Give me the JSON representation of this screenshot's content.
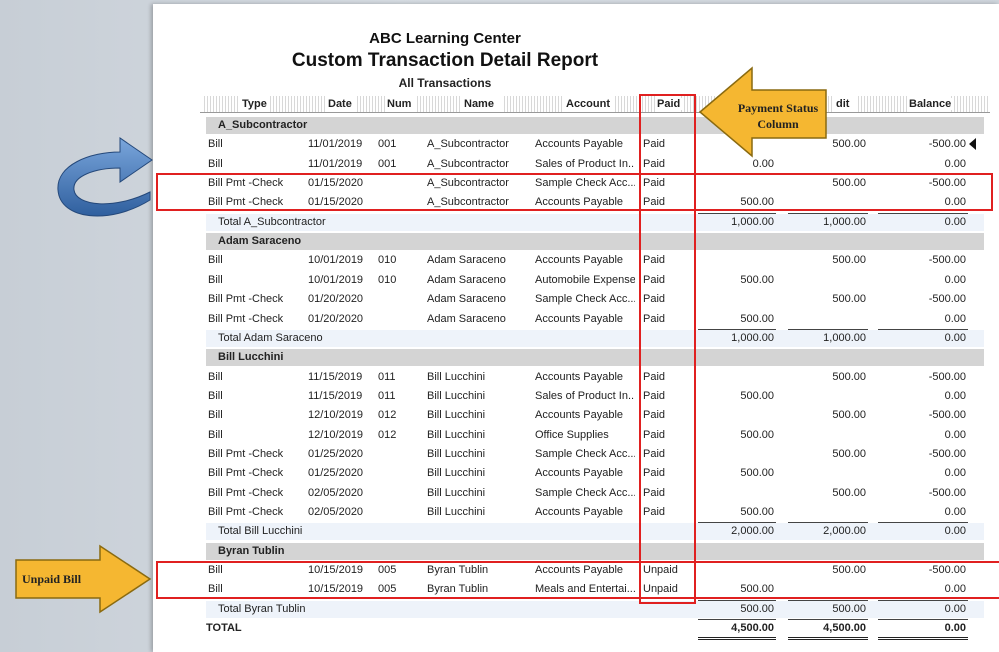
{
  "report": {
    "company": "ABC Learning Center",
    "title": "Custom Transaction Detail Report",
    "subtitle": "All Transactions"
  },
  "columns": {
    "type": "Type",
    "date": "Date",
    "num": "Num",
    "name": "Name",
    "account": "Account",
    "paid": "Paid",
    "credit": "dit",
    "balance": "Balance"
  },
  "groups": [
    {
      "name": "A_Subcontractor",
      "rows": [
        {
          "type": "Bill",
          "date": "11/01/2019",
          "num": "001",
          "name": "A_Subcontractor",
          "account": "Accounts Payable",
          "paid": "Paid",
          "debit": "",
          "credit": "500.00",
          "balance": "-500.00"
        },
        {
          "type": "Bill",
          "date": "11/01/2019",
          "num": "001",
          "name": "A_Subcontractor",
          "account": "Sales of Product In...",
          "paid": "Paid",
          "debit": "0.00",
          "credit": "",
          "balance": "0.00"
        },
        {
          "type": "Bill Pmt -Check",
          "date": "01/15/2020",
          "num": "",
          "name": "A_Subcontractor",
          "account": "Sample Check Acc...",
          "paid": "Paid",
          "debit": "",
          "credit": "500.00",
          "balance": "-500.00"
        },
        {
          "type": "Bill Pmt -Check",
          "date": "01/15/2020",
          "num": "",
          "name": "A_Subcontractor",
          "account": "Accounts Payable",
          "paid": "Paid",
          "debit": "500.00",
          "credit": "",
          "balance": "0.00"
        }
      ],
      "total": {
        "label": "Total A_Subcontractor",
        "debit": "1,000.00",
        "credit": "1,000.00",
        "balance": "0.00"
      }
    },
    {
      "name": "Adam Saraceno",
      "rows": [
        {
          "type": "Bill",
          "date": "10/01/2019",
          "num": "010",
          "name": "Adam Saraceno",
          "account": "Accounts Payable",
          "paid": "Paid",
          "debit": "",
          "credit": "500.00",
          "balance": "-500.00"
        },
        {
          "type": "Bill",
          "date": "10/01/2019",
          "num": "010",
          "name": "Adam Saraceno",
          "account": "Automobile Expense",
          "paid": "Paid",
          "debit": "500.00",
          "credit": "",
          "balance": "0.00"
        },
        {
          "type": "Bill Pmt -Check",
          "date": "01/20/2020",
          "num": "",
          "name": "Adam Saraceno",
          "account": "Sample Check Acc...",
          "paid": "Paid",
          "debit": "",
          "credit": "500.00",
          "balance": "-500.00"
        },
        {
          "type": "Bill Pmt -Check",
          "date": "01/20/2020",
          "num": "",
          "name": "Adam Saraceno",
          "account": "Accounts Payable",
          "paid": "Paid",
          "debit": "500.00",
          "credit": "",
          "balance": "0.00"
        }
      ],
      "total": {
        "label": "Total Adam Saraceno",
        "debit": "1,000.00",
        "credit": "1,000.00",
        "balance": "0.00"
      }
    },
    {
      "name": "Bill Lucchini",
      "rows": [
        {
          "type": "Bill",
          "date": "11/15/2019",
          "num": "011",
          "name": "Bill Lucchini",
          "account": "Accounts Payable",
          "paid": "Paid",
          "debit": "",
          "credit": "500.00",
          "balance": "-500.00"
        },
        {
          "type": "Bill",
          "date": "11/15/2019",
          "num": "011",
          "name": "Bill Lucchini",
          "account": "Sales of Product In...",
          "paid": "Paid",
          "debit": "500.00",
          "credit": "",
          "balance": "0.00"
        },
        {
          "type": "Bill",
          "date": "12/10/2019",
          "num": "012",
          "name": "Bill Lucchini",
          "account": "Accounts Payable",
          "paid": "Paid",
          "debit": "",
          "credit": "500.00",
          "balance": "-500.00"
        },
        {
          "type": "Bill",
          "date": "12/10/2019",
          "num": "012",
          "name": "Bill Lucchini",
          "account": "Office Supplies",
          "paid": "Paid",
          "debit": "500.00",
          "credit": "",
          "balance": "0.00"
        },
        {
          "type": "Bill Pmt -Check",
          "date": "01/25/2020",
          "num": "",
          "name": "Bill Lucchini",
          "account": "Sample Check Acc...",
          "paid": "Paid",
          "debit": "",
          "credit": "500.00",
          "balance": "-500.00"
        },
        {
          "type": "Bill Pmt -Check",
          "date": "01/25/2020",
          "num": "",
          "name": "Bill Lucchini",
          "account": "Accounts Payable",
          "paid": "Paid",
          "debit": "500.00",
          "credit": "",
          "balance": "0.00"
        },
        {
          "type": "Bill Pmt -Check",
          "date": "02/05/2020",
          "num": "",
          "name": "Bill Lucchini",
          "account": "Sample Check Acc...",
          "paid": "Paid",
          "debit": "",
          "credit": "500.00",
          "balance": "-500.00"
        },
        {
          "type": "Bill Pmt -Check",
          "date": "02/05/2020",
          "num": "",
          "name": "Bill Lucchini",
          "account": "Accounts Payable",
          "paid": "Paid",
          "debit": "500.00",
          "credit": "",
          "balance": "0.00"
        }
      ],
      "total": {
        "label": "Total Bill Lucchini",
        "debit": "2,000.00",
        "credit": "2,000.00",
        "balance": "0.00"
      }
    },
    {
      "name": "Byran Tublin",
      "rows": [
        {
          "type": "Bill",
          "date": "10/15/2019",
          "num": "005",
          "name": "Byran Tublin",
          "account": "Accounts Payable",
          "paid": "Unpaid",
          "debit": "",
          "credit": "500.00",
          "balance": "-500.00"
        },
        {
          "type": "Bill",
          "date": "10/15/2019",
          "num": "005",
          "name": "Byran Tublin",
          "account": "Meals and Entertai...",
          "paid": "Unpaid",
          "debit": "500.00",
          "credit": "",
          "balance": "0.00"
        }
      ],
      "total": {
        "label": "Total Byran Tublin",
        "debit": "500.00",
        "credit": "500.00",
        "balance": "0.00"
      }
    }
  ],
  "grand_total": {
    "label": "TOTAL",
    "debit": "4,500.00",
    "credit": "4,500.00",
    "balance": "0.00"
  },
  "annotations": {
    "payment_status": "Payment Status Column",
    "unpaid_bill": "Unpaid Bill"
  },
  "colors": {
    "highlight_box": "#e02020",
    "callout_fill": "#f5b731",
    "curved_arrow": "#4a7fc0"
  }
}
